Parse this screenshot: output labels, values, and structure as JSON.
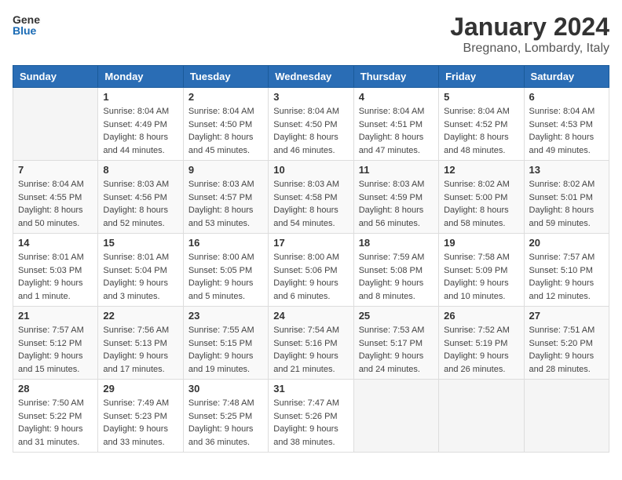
{
  "header": {
    "logo_general": "General",
    "logo_blue": "Blue",
    "month_title": "January 2024",
    "location": "Bregnano, Lombardy, Italy"
  },
  "weekdays": [
    "Sunday",
    "Monday",
    "Tuesday",
    "Wednesday",
    "Thursday",
    "Friday",
    "Saturday"
  ],
  "weeks": [
    [
      {
        "day": "",
        "sunrise": "",
        "sunset": "",
        "daylight": ""
      },
      {
        "day": "1",
        "sunrise": "Sunrise: 8:04 AM",
        "sunset": "Sunset: 4:49 PM",
        "daylight": "Daylight: 8 hours and 44 minutes."
      },
      {
        "day": "2",
        "sunrise": "Sunrise: 8:04 AM",
        "sunset": "Sunset: 4:50 PM",
        "daylight": "Daylight: 8 hours and 45 minutes."
      },
      {
        "day": "3",
        "sunrise": "Sunrise: 8:04 AM",
        "sunset": "Sunset: 4:50 PM",
        "daylight": "Daylight: 8 hours and 46 minutes."
      },
      {
        "day": "4",
        "sunrise": "Sunrise: 8:04 AM",
        "sunset": "Sunset: 4:51 PM",
        "daylight": "Daylight: 8 hours and 47 minutes."
      },
      {
        "day": "5",
        "sunrise": "Sunrise: 8:04 AM",
        "sunset": "Sunset: 4:52 PM",
        "daylight": "Daylight: 8 hours and 48 minutes."
      },
      {
        "day": "6",
        "sunrise": "Sunrise: 8:04 AM",
        "sunset": "Sunset: 4:53 PM",
        "daylight": "Daylight: 8 hours and 49 minutes."
      }
    ],
    [
      {
        "day": "7",
        "sunrise": "Sunrise: 8:04 AM",
        "sunset": "Sunset: 4:55 PM",
        "daylight": "Daylight: 8 hours and 50 minutes."
      },
      {
        "day": "8",
        "sunrise": "Sunrise: 8:03 AM",
        "sunset": "Sunset: 4:56 PM",
        "daylight": "Daylight: 8 hours and 52 minutes."
      },
      {
        "day": "9",
        "sunrise": "Sunrise: 8:03 AM",
        "sunset": "Sunset: 4:57 PM",
        "daylight": "Daylight: 8 hours and 53 minutes."
      },
      {
        "day": "10",
        "sunrise": "Sunrise: 8:03 AM",
        "sunset": "Sunset: 4:58 PM",
        "daylight": "Daylight: 8 hours and 54 minutes."
      },
      {
        "day": "11",
        "sunrise": "Sunrise: 8:03 AM",
        "sunset": "Sunset: 4:59 PM",
        "daylight": "Daylight: 8 hours and 56 minutes."
      },
      {
        "day": "12",
        "sunrise": "Sunrise: 8:02 AM",
        "sunset": "Sunset: 5:00 PM",
        "daylight": "Daylight: 8 hours and 58 minutes."
      },
      {
        "day": "13",
        "sunrise": "Sunrise: 8:02 AM",
        "sunset": "Sunset: 5:01 PM",
        "daylight": "Daylight: 8 hours and 59 minutes."
      }
    ],
    [
      {
        "day": "14",
        "sunrise": "Sunrise: 8:01 AM",
        "sunset": "Sunset: 5:03 PM",
        "daylight": "Daylight: 9 hours and 1 minute."
      },
      {
        "day": "15",
        "sunrise": "Sunrise: 8:01 AM",
        "sunset": "Sunset: 5:04 PM",
        "daylight": "Daylight: 9 hours and 3 minutes."
      },
      {
        "day": "16",
        "sunrise": "Sunrise: 8:00 AM",
        "sunset": "Sunset: 5:05 PM",
        "daylight": "Daylight: 9 hours and 5 minutes."
      },
      {
        "day": "17",
        "sunrise": "Sunrise: 8:00 AM",
        "sunset": "Sunset: 5:06 PM",
        "daylight": "Daylight: 9 hours and 6 minutes."
      },
      {
        "day": "18",
        "sunrise": "Sunrise: 7:59 AM",
        "sunset": "Sunset: 5:08 PM",
        "daylight": "Daylight: 9 hours and 8 minutes."
      },
      {
        "day": "19",
        "sunrise": "Sunrise: 7:58 AM",
        "sunset": "Sunset: 5:09 PM",
        "daylight": "Daylight: 9 hours and 10 minutes."
      },
      {
        "day": "20",
        "sunrise": "Sunrise: 7:57 AM",
        "sunset": "Sunset: 5:10 PM",
        "daylight": "Daylight: 9 hours and 12 minutes."
      }
    ],
    [
      {
        "day": "21",
        "sunrise": "Sunrise: 7:57 AM",
        "sunset": "Sunset: 5:12 PM",
        "daylight": "Daylight: 9 hours and 15 minutes."
      },
      {
        "day": "22",
        "sunrise": "Sunrise: 7:56 AM",
        "sunset": "Sunset: 5:13 PM",
        "daylight": "Daylight: 9 hours and 17 minutes."
      },
      {
        "day": "23",
        "sunrise": "Sunrise: 7:55 AM",
        "sunset": "Sunset: 5:15 PM",
        "daylight": "Daylight: 9 hours and 19 minutes."
      },
      {
        "day": "24",
        "sunrise": "Sunrise: 7:54 AM",
        "sunset": "Sunset: 5:16 PM",
        "daylight": "Daylight: 9 hours and 21 minutes."
      },
      {
        "day": "25",
        "sunrise": "Sunrise: 7:53 AM",
        "sunset": "Sunset: 5:17 PM",
        "daylight": "Daylight: 9 hours and 24 minutes."
      },
      {
        "day": "26",
        "sunrise": "Sunrise: 7:52 AM",
        "sunset": "Sunset: 5:19 PM",
        "daylight": "Daylight: 9 hours and 26 minutes."
      },
      {
        "day": "27",
        "sunrise": "Sunrise: 7:51 AM",
        "sunset": "Sunset: 5:20 PM",
        "daylight": "Daylight: 9 hours and 28 minutes."
      }
    ],
    [
      {
        "day": "28",
        "sunrise": "Sunrise: 7:50 AM",
        "sunset": "Sunset: 5:22 PM",
        "daylight": "Daylight: 9 hours and 31 minutes."
      },
      {
        "day": "29",
        "sunrise": "Sunrise: 7:49 AM",
        "sunset": "Sunset: 5:23 PM",
        "daylight": "Daylight: 9 hours and 33 minutes."
      },
      {
        "day": "30",
        "sunrise": "Sunrise: 7:48 AM",
        "sunset": "Sunset: 5:25 PM",
        "daylight": "Daylight: 9 hours and 36 minutes."
      },
      {
        "day": "31",
        "sunrise": "Sunrise: 7:47 AM",
        "sunset": "Sunset: 5:26 PM",
        "daylight": "Daylight: 9 hours and 38 minutes."
      },
      {
        "day": "",
        "sunrise": "",
        "sunset": "",
        "daylight": ""
      },
      {
        "day": "",
        "sunrise": "",
        "sunset": "",
        "daylight": ""
      },
      {
        "day": "",
        "sunrise": "",
        "sunset": "",
        "daylight": ""
      }
    ]
  ]
}
